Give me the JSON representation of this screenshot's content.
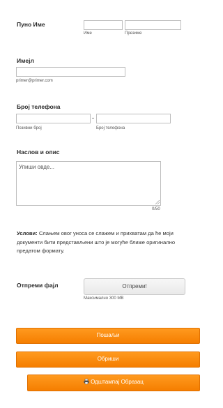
{
  "full_name": {
    "label": "Пуно Име",
    "first_sub": "Име",
    "last_sub": "Презиме",
    "first_value": "",
    "last_value": ""
  },
  "email": {
    "label": "Имејл",
    "value": "",
    "sub": "primer@primer.com"
  },
  "phone": {
    "label": "Број телефона",
    "area_value": "",
    "area_sub": "Позивни број",
    "dash": "-",
    "number_value": "",
    "number_sub": "Број телефона"
  },
  "description": {
    "label": "Наслов и опис",
    "placeholder": "Упиши овде...",
    "counter": "0/50"
  },
  "terms": {
    "title": "Услови:",
    "text": " Слањем овог уноса се слажем и прихватам да ће моји документи бити представљени што је могуће ближе оригинално предатом формату."
  },
  "file_upload": {
    "label": "Отпреми фајл",
    "button": "Отпреми!",
    "sub": "Максимално 300 MB"
  },
  "buttons": {
    "submit": "Пошаљи",
    "clear": "Обриши",
    "print": "Одштампај Образац"
  },
  "colors": {
    "accent": "#f78a0c",
    "accent_border": "#e07000"
  },
  "icons": {
    "print": "printer-icon"
  }
}
